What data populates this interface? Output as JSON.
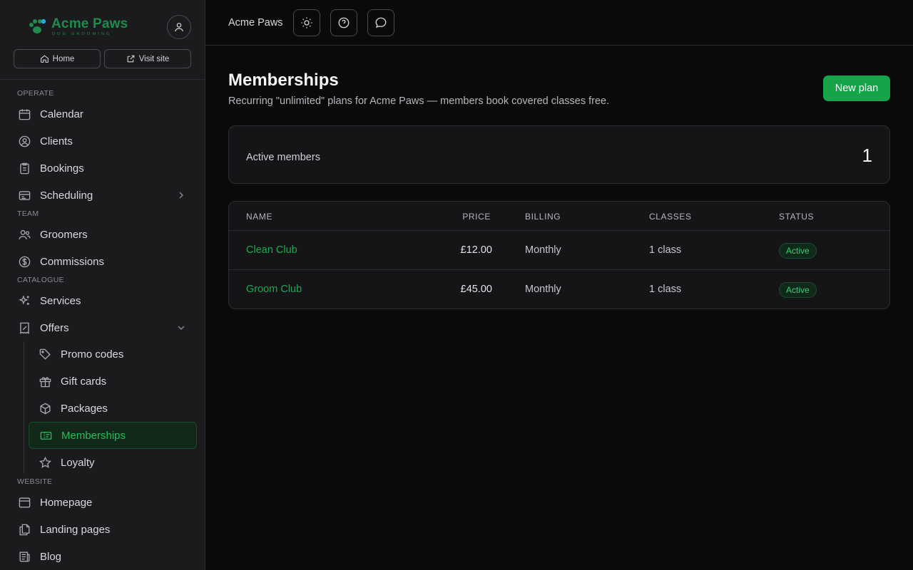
{
  "brand": {
    "name": "Acme Paws",
    "tagline": "DOG GROOMING",
    "color": "#1f8b4c"
  },
  "sidebar": {
    "home_label": "Home",
    "visit_label": "Visit site",
    "sections": {
      "operate": "OPERATE",
      "team": "TEAM",
      "catalogue": "CATALOGUE",
      "website": "WEBSITE"
    },
    "items": {
      "calendar": "Calendar",
      "clients": "Clients",
      "bookings": "Bookings",
      "scheduling": "Scheduling",
      "groomers": "Groomers",
      "commissions": "Commissions",
      "services": "Services",
      "offers": "Offers",
      "promo_codes": "Promo codes",
      "gift_cards": "Gift cards",
      "packages": "Packages",
      "memberships": "Memberships",
      "loyalty": "Loyalty",
      "homepage": "Homepage",
      "landing_pages": "Landing pages",
      "blog": "Blog"
    },
    "active_item": "memberships",
    "accent": "#16a34a"
  },
  "topbar": {
    "title": "Acme Paws"
  },
  "page": {
    "title": "Memberships",
    "subtitle": "Recurring \"unlimited\" plans for Acme Paws — members book covered classes free.",
    "new_button": "New plan"
  },
  "stats": {
    "active_members_label": "Active members",
    "active_members_value": "1"
  },
  "table": {
    "headers": {
      "name": "NAME",
      "price": "PRICE",
      "billing": "BILLING",
      "classes": "CLASSES",
      "status": "STATUS"
    },
    "rows": [
      {
        "name": "Clean Club",
        "price": "£12.00",
        "billing": "Monthly",
        "classes": "1 class",
        "status": "Active"
      },
      {
        "name": "Groom Club",
        "price": "£45.00",
        "billing": "Monthly",
        "classes": "1 class",
        "status": "Active"
      }
    ]
  }
}
